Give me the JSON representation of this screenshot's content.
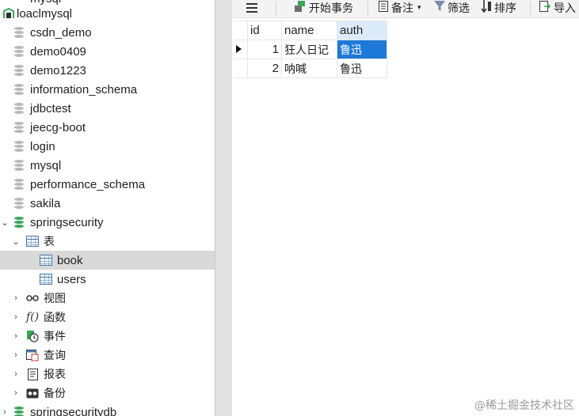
{
  "tree": {
    "top_partial": "mysql",
    "connection": "loaclmysql",
    "databases": [
      "csdn_demo",
      "demo0409",
      "demo1223",
      "information_schema",
      "jdbctest",
      "jeecg-boot",
      "login",
      "mysql",
      "performance_schema",
      "sakila"
    ],
    "open_db": "springsecurity",
    "tables_folder": "表",
    "tables": [
      "book",
      "users"
    ],
    "selected_table": "book",
    "folders": [
      {
        "label": "视图",
        "icon": "view-icon"
      },
      {
        "label": "函数",
        "icon": "function-icon"
      },
      {
        "label": "事件",
        "icon": "event-icon"
      },
      {
        "label": "查询",
        "icon": "query-icon"
      },
      {
        "label": "报表",
        "icon": "report-icon"
      },
      {
        "label": "备份",
        "icon": "backup-icon"
      }
    ],
    "next_db": "springsecuritydb"
  },
  "toolbar": {
    "begin_transaction": "开始事务",
    "note": "备注",
    "filter": "筛选",
    "sort": "排序",
    "import": "导入"
  },
  "grid": {
    "columns": [
      "id",
      "name",
      "auth"
    ],
    "rows": [
      {
        "id": "1",
        "name": "狂人日记",
        "auth": "鲁迅"
      },
      {
        "id": "2",
        "name": "呐喊",
        "auth": "鲁迅"
      }
    ]
  },
  "watermark": "@稀土掘金技术社区",
  "colors": {
    "selection": "#1e78d8",
    "db_green": "#3aa65a",
    "row_selected": "#d9d9d9"
  }
}
